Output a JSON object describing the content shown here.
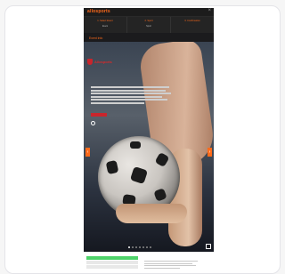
{
  "app": {
    "brand": "allosports"
  },
  "steps": [
    {
      "label": "1. Select Event",
      "value": "Event"
    },
    {
      "label": "2. Sport",
      "value": "Sport"
    },
    {
      "label": "3. Confirmation",
      "value": ""
    }
  ],
  "section": {
    "title": "Event Info"
  },
  "hero": {
    "logo_text": "Allosports",
    "heading": "",
    "subheading": "",
    "tag": "",
    "link": ""
  },
  "bottom": {
    "title": "",
    "green_label": "",
    "right_title": ""
  },
  "colors": {
    "accent": "#ff6a1a",
    "brand_red": "#c9252c",
    "green": "#4ed36a"
  }
}
